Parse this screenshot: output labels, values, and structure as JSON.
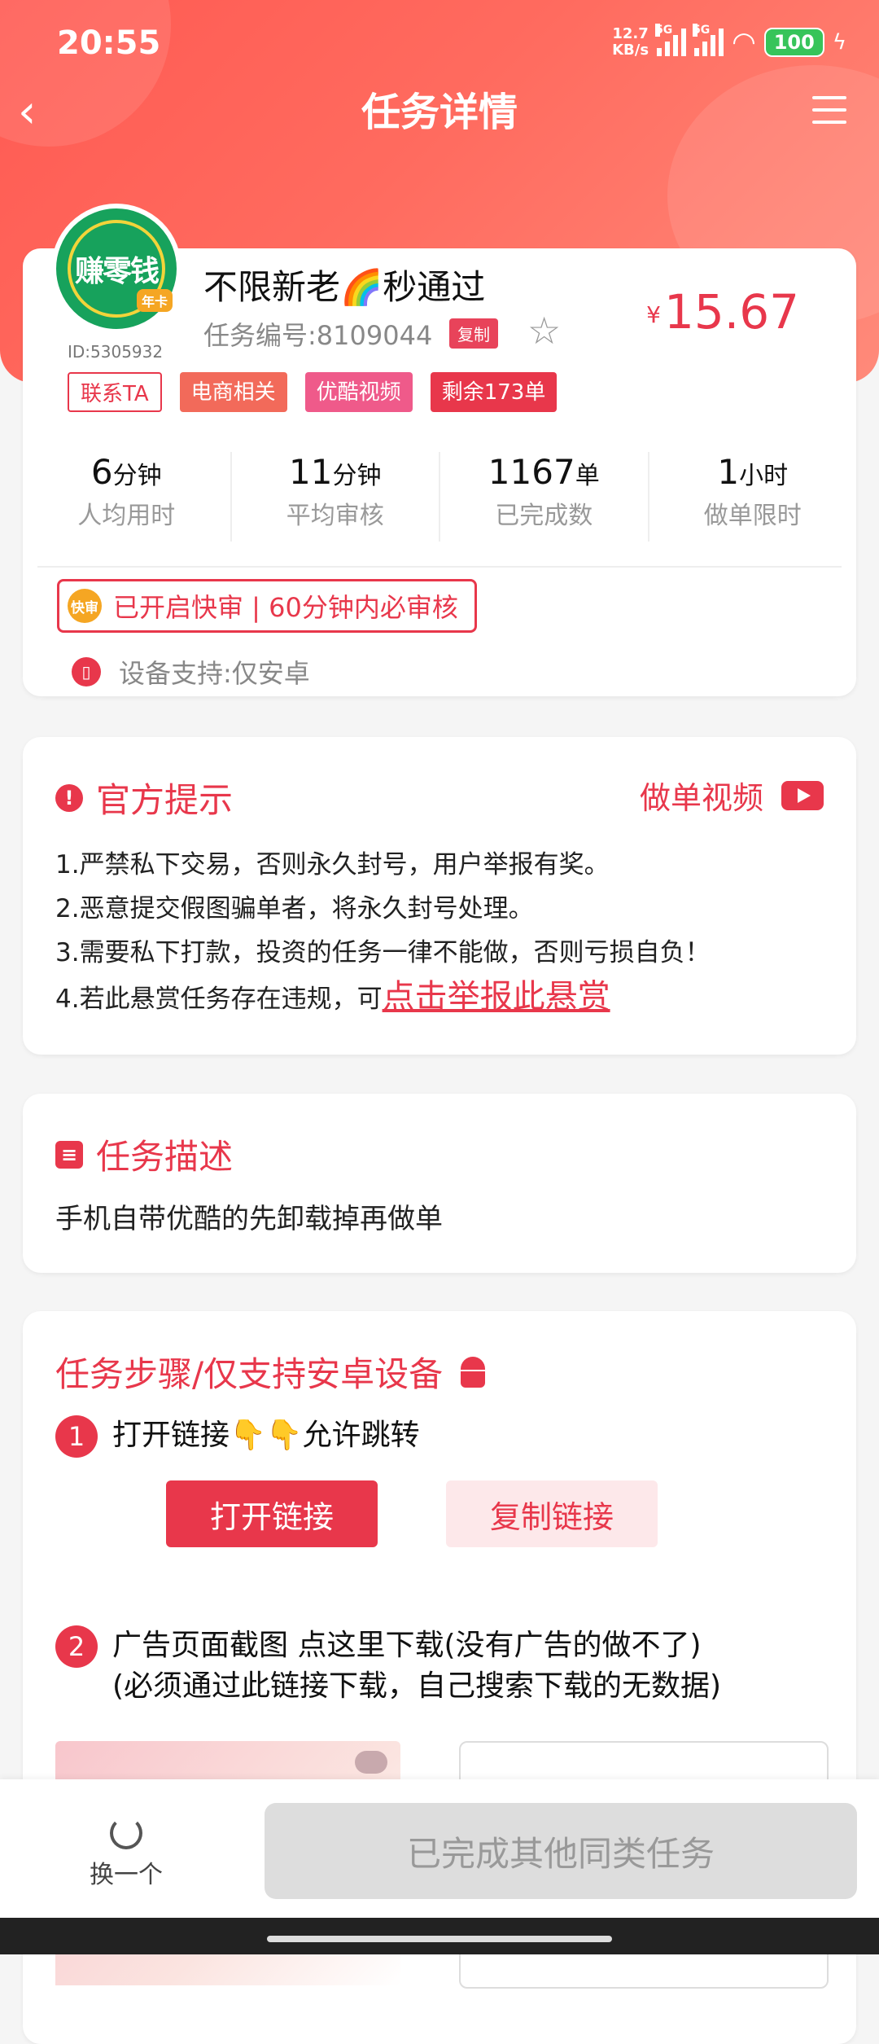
{
  "status_bar": {
    "time": "20:55",
    "net_speed_value": "12.7",
    "net_speed_unit": "KB/s",
    "signal1_label": "5G",
    "signal2_label": "5G",
    "battery": "100"
  },
  "nav": {
    "title": "任务详情"
  },
  "task": {
    "avatar_text": "赚零钱",
    "crown_label": "年卡",
    "user_id": "ID:5305932",
    "title": "不限新老🌈秒通过",
    "task_no": "任务编号:8109044",
    "copy_label": "复制",
    "price_symbol": "¥",
    "price": "15.67",
    "tags": {
      "contact": "联系TA",
      "tag1": "电商相关",
      "tag2": "优酷视频",
      "tag3": "剩余173单"
    },
    "stats": [
      {
        "value": "6",
        "unit": "分钟",
        "label": "人均用时"
      },
      {
        "value": "11",
        "unit": "分钟",
        "label": "平均审核"
      },
      {
        "value": "1167",
        "unit": "单",
        "label": "已完成数"
      },
      {
        "value": "1",
        "unit": "小时",
        "label": "做单限时"
      }
    ],
    "fast_icon_label": "快审",
    "fast_text": "已开启快审 | 60分钟内必审核",
    "device_text": "设备支持:仅安卓"
  },
  "notice": {
    "title": "官方提示",
    "video_label": "做单视频",
    "rules": [
      "1.严禁私下交易，否则永久封号，用户举报有奖。",
      "2.恶意提交假图骗单者，将永久封号处理。",
      "3.需要私下打款，投资的任务一律不能做，否则亏损自负！",
      "4.若此悬赏任务存在违规，可"
    ],
    "report_link": "点击举报此悬赏"
  },
  "description": {
    "title": "任务描述",
    "text": "手机自带优酷的先卸载掉再做单"
  },
  "steps": {
    "title": "任务步骤/仅支持安卓设备",
    "step1_num": "1",
    "step1_text": "打开链接👇👇允许跳转",
    "open_button": "打开链接",
    "copy_button": "复制链接",
    "step2_num": "2",
    "step2_line1": "广告页面截图  点这里下载(没有广告的做不了)",
    "step2_line2": "(必须通过此链接下载，自己搜索下载的无数据)"
  },
  "bottom": {
    "swap_label": "换一个",
    "done_label": "已完成其他同类任务"
  },
  "colors": {
    "accent": "#e8374b",
    "header": "#ff5a52"
  }
}
